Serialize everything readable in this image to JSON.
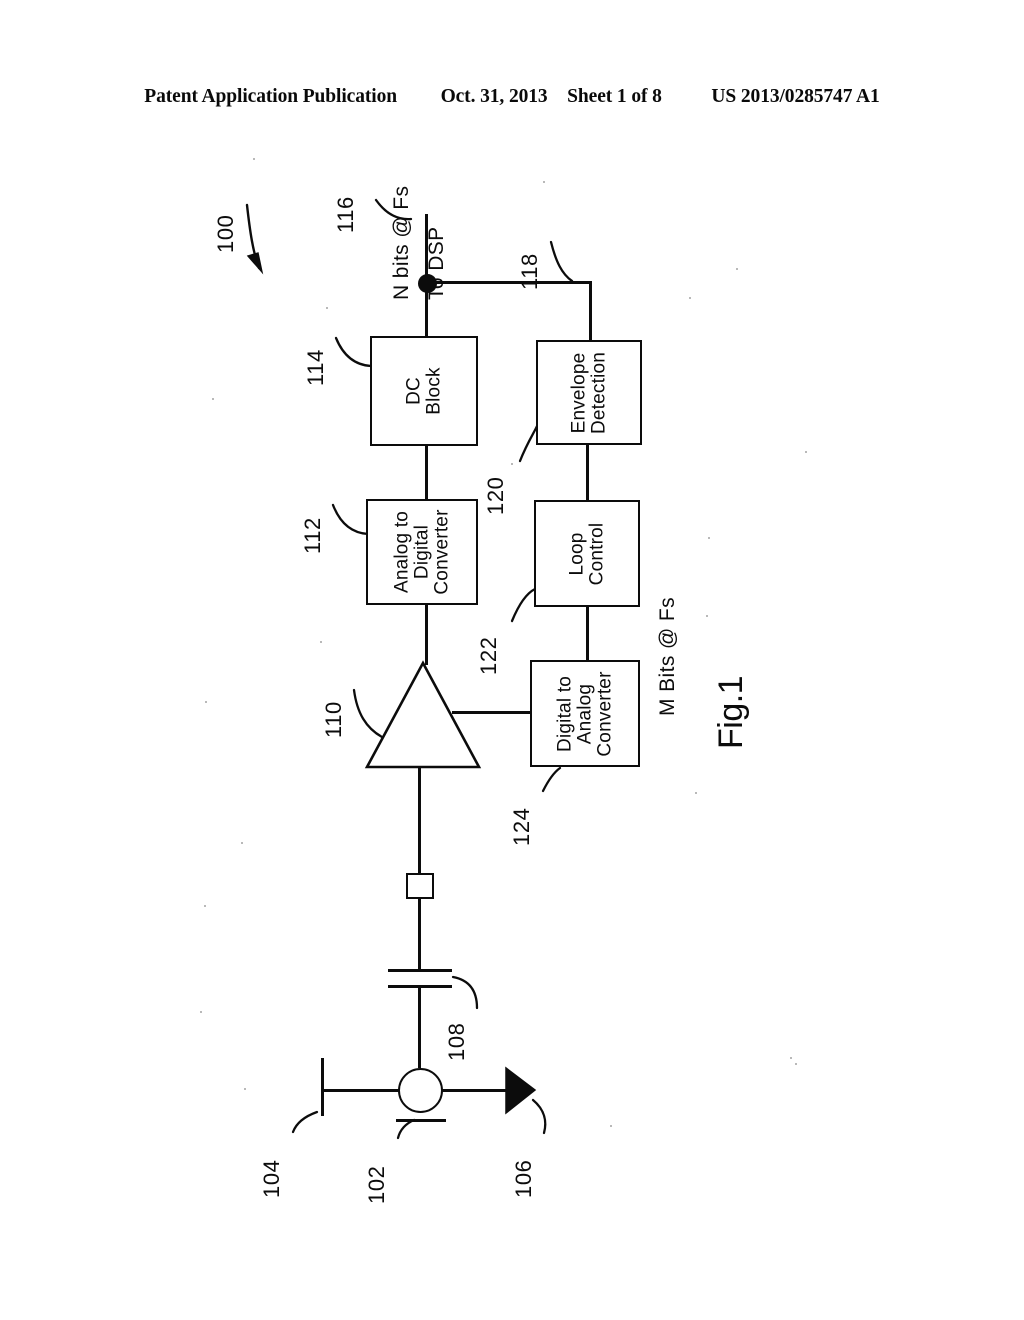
{
  "header": {
    "left": "Patent Application Publication",
    "date": "Oct. 31, 2013",
    "sheet": "Sheet 1 of 8",
    "patent_number": "US 2013/0285747 A1"
  },
  "figure": {
    "label": "Fig.1",
    "system_ref": "100",
    "blocks": [
      {
        "ref": "114",
        "line1": "DC",
        "line2": "Block",
        "line3": ""
      },
      {
        "ref": "112",
        "line1": "Analog to",
        "line2": "Digital",
        "line3": "Converter"
      },
      {
        "ref": "120",
        "line1": "Envelope",
        "line2": "Detection",
        "line3": ""
      },
      {
        "ref": "122",
        "line1": "Loop",
        "line2": "Control",
        "line3": ""
      },
      {
        "ref": "124",
        "line1": "Digital to",
        "line2": "Analog",
        "line3": "Converter"
      }
    ],
    "symbols": [
      {
        "ref": "102",
        "name": "circulator"
      },
      {
        "ref": "104",
        "name": "antenna-port"
      },
      {
        "ref": "106",
        "name": "termination-arrow"
      },
      {
        "ref": "108",
        "name": "capacitor"
      },
      {
        "ref": "110",
        "name": "amplifier"
      },
      {
        "ref": "116",
        "name": "output-node"
      },
      {
        "ref": "118",
        "name": "feedback-tap"
      }
    ],
    "annotations": {
      "n_bits": "N bits @ Fs",
      "to_dsp": "To DSP",
      "m_bits": "M Bits @ Fs"
    },
    "ref_100": "100",
    "ref_102": "102",
    "ref_104": "104",
    "ref_106": "106",
    "ref_108": "108",
    "ref_110": "110",
    "ref_112": "112",
    "ref_114": "114",
    "ref_116": "116",
    "ref_118": "118",
    "ref_120": "120",
    "ref_122": "122",
    "ref_124": "124"
  },
  "colors": {
    "ink": "#0c0c0c",
    "paper": "#ffffff"
  }
}
